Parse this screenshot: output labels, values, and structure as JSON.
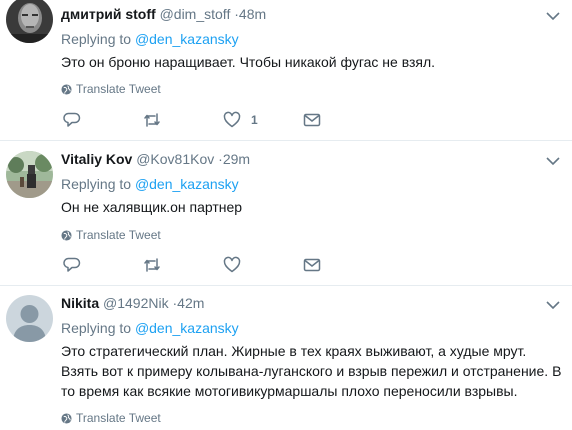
{
  "tweets": [
    {
      "display_name": "дмитрий stoff",
      "handle": "@dim_stoff",
      "dot": "·",
      "time": "48m",
      "replying_prefix": "Replying to",
      "replying_mention": "@den_kazansky",
      "text": "Это он броню наращивает. Чтобы никакой фугас не взял.",
      "translate_label": "Translate Tweet",
      "like_count": "1"
    },
    {
      "display_name": "Vitaliy Kov",
      "handle": "@Kov81Kov",
      "dot": "·",
      "time": "29m",
      "replying_prefix": "Replying to",
      "replying_mention": "@den_kazansky",
      "text": "Он не халявщик.он партнер",
      "translate_label": "Translate Tweet",
      "like_count": ""
    },
    {
      "display_name": "Nikita",
      "handle": "@1492Nik",
      "dot": "·",
      "time": "42m",
      "replying_prefix": "Replying to",
      "replying_mention": "@den_kazansky",
      "text": "Это стратегический план. Жирные в тех краях выживают, а худые мрут. Взять вот к примеру колывана-луганского и взрыв пережил и отстранение. В то время как всякие мотогивикурмаршалы плохо переносили взрывы.",
      "translate_label": "Translate Tweet",
      "like_count": ""
    }
  ],
  "colors": {
    "link": "#1da1f2",
    "secondary_text": "#657786",
    "divider": "#e6ecf0"
  },
  "icons": [
    "caret-down-icon",
    "globe-icon",
    "reply-icon",
    "retweet-icon",
    "like-icon",
    "direct-message-icon"
  ]
}
